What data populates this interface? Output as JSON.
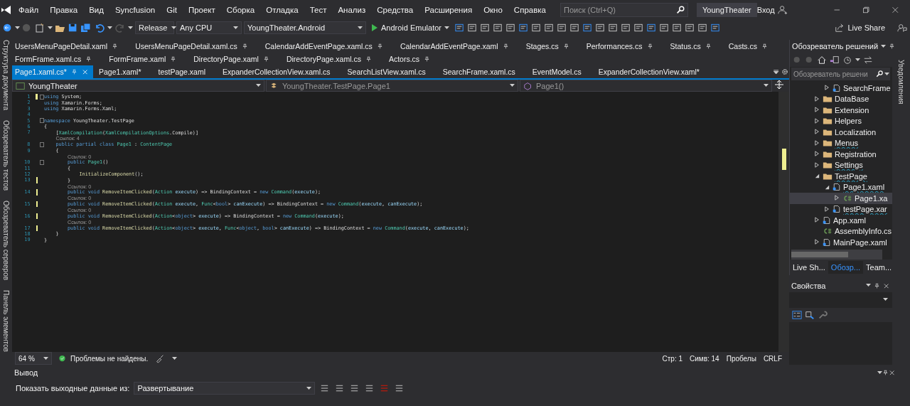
{
  "menu": [
    "Файл",
    "Правка",
    "Вид",
    "Syncfusion",
    "Git",
    "Проект",
    "Сборка",
    "Отладка",
    "Тест",
    "Анализ",
    "Средства",
    "Расширения",
    "Окно",
    "Справка"
  ],
  "search": {
    "placeholder": "Поиск (Ctrl+Q)"
  },
  "window": {
    "title": "YoungTheater",
    "sign_in": "Вход"
  },
  "toolbar": {
    "configuration": "Release",
    "platform": "Any CPU",
    "project": "YoungTheater.Android",
    "run_target": "Android Emulator",
    "live_share": "Live Share"
  },
  "left_strip": [
    "Структура документа",
    "Обозреватель тестов",
    "Обозреватель серверов",
    "Панель элементов"
  ],
  "tab_rows": [
    [
      {
        "label": "UsersMenuPageDetail.xaml",
        "pinned": true,
        "selected": false
      },
      {
        "label": "UsersMenuPageDetail.xaml.cs",
        "pinned": true,
        "selected": false
      },
      {
        "label": "CalendarAddEventPage.xaml.cs",
        "pinned": true,
        "selected": false
      },
      {
        "label": "CalendarAddEventPage.xaml",
        "pinned": true,
        "selected": false
      },
      {
        "label": "Stages.cs",
        "pinned": true,
        "selected": false
      },
      {
        "label": "Performances.cs",
        "pinned": true,
        "selected": false
      },
      {
        "label": "Status.cs",
        "pinned": true,
        "selected": false
      },
      {
        "label": "Casts.cs",
        "pinned": true,
        "selected": false
      }
    ],
    [
      {
        "label": "FormFrame.xaml.cs",
        "pinned": true,
        "selected": false
      },
      {
        "label": "FormFrame.xaml",
        "pinned": true,
        "selected": false
      },
      {
        "label": "DirectoryPage.xaml",
        "pinned": true,
        "selected": false
      },
      {
        "label": "DirectoryPage.xaml.cs",
        "pinned": true,
        "selected": false
      },
      {
        "label": "Actors.cs",
        "pinned": true,
        "selected": false
      }
    ],
    [
      {
        "label": "Page1.xaml.cs*",
        "pinned": true,
        "selected": true
      },
      {
        "label": "Page1.xaml*",
        "pinned": false,
        "selected": false
      },
      {
        "label": "testPage.xaml",
        "pinned": false,
        "selected": false
      },
      {
        "label": "ExpanderCollectionView.xaml.cs",
        "pinned": false,
        "selected": false
      },
      {
        "label": "SearchListView.xaml.cs",
        "pinned": false,
        "selected": false
      },
      {
        "label": "SearchFrame.xaml.cs",
        "pinned": false,
        "selected": false
      },
      {
        "label": "EventModel.cs",
        "pinned": false,
        "selected": false
      },
      {
        "label": "ExpanderCollectionView.xaml*",
        "pinned": false,
        "selected": false
      }
    ]
  ],
  "navbar": {
    "project": "YoungTheater",
    "type": "YoungTheater.TestPage.Page1",
    "member": "Page1()"
  },
  "code": [
    {
      "kind": "line",
      "number": "1",
      "changed": true,
      "fold": true,
      "tokens": [
        {
          "text": "using",
          "kind": "keyword"
        },
        {
          "text": " System;",
          "kind": "plain"
        }
      ]
    },
    {
      "kind": "line",
      "number": "2",
      "changed": false,
      "fold": false,
      "tokens": [
        {
          "text": "using",
          "kind": "keyword"
        },
        {
          "text": " Xamarin.Forms;",
          "kind": "plain"
        }
      ]
    },
    {
      "kind": "line",
      "number": "3",
      "changed": false,
      "fold": false,
      "tokens": [
        {
          "text": "using",
          "kind": "keyword"
        },
        {
          "text": " Xamarin.Forms.Xaml;",
          "kind": "plain"
        }
      ]
    },
    {
      "kind": "line",
      "number": "4",
      "changed": false,
      "fold": false
    },
    {
      "kind": "line",
      "number": "5",
      "changed": false,
      "fold": true,
      "tokens": [
        {
          "text": "namespace",
          "kind": "keyword"
        },
        {
          "text": " YoungTheater.TestPage",
          "kind": "plain"
        }
      ]
    },
    {
      "kind": "line",
      "number": "6",
      "changed": false,
      "fold": false,
      "tokens": [
        {
          "text": "{",
          "kind": "plain"
        }
      ],
      "children": [
        {
          "kind": "line",
          "number": "7",
          "changed": false,
          "fold": false,
          "tokens": [
            {
              "text": "[",
              "kind": "plain"
            },
            {
              "text": "XamlCompilation",
              "kind": "type"
            },
            {
              "text": "(",
              "kind": "plain"
            },
            {
              "text": "XamlCompilationOptions",
              "kind": "type"
            },
            {
              "text": ".Compile)]",
              "kind": "plain"
            }
          ]
        },
        {
          "kind": "lens",
          "text": "Ссылок: 4"
        },
        {
          "kind": "line",
          "number": "8",
          "changed": false,
          "fold": true,
          "tokens": [
            {
              "text": "public partial class",
              "kind": "keyword"
            },
            {
              "text": " Page1",
              "kind": "type"
            },
            {
              "text": " : ",
              "kind": "plain"
            },
            {
              "text": "ContentPage",
              "kind": "type"
            }
          ]
        },
        {
          "kind": "line",
          "number": "9",
          "changed": false,
          "fold": false,
          "tokens": [
            {
              "text": "{",
              "kind": "plain"
            }
          ],
          "children": [
            {
              "kind": "lens",
              "text": "Ссылок: 0"
            },
            {
              "kind": "line",
              "number": "10",
              "changed": false,
              "fold": true,
              "tokens": [
                {
                  "text": "public",
                  "kind": "keyword"
                },
                {
                  "text": " Page1",
                  "kind": "type"
                },
                {
                  "text": "()",
                  "kind": "plain"
                }
              ]
            },
            {
              "kind": "line",
              "number": "11",
              "changed": false,
              "fold": false,
              "tokens": [
                {
                  "text": "{",
                  "kind": "plain"
                }
              ],
              "children": [
                {
                  "kind": "line",
                  "number": "12",
                  "changed": false,
                  "fold": false,
                  "tokens": [
                    {
                      "text": "InitializeComponent",
                      "kind": "method"
                    },
                    {
                      "text": "();",
                      "kind": "plain"
                    }
                  ]
                }
              ]
            },
            {
              "kind": "line",
              "number": "13",
              "changed": true,
              "fold": false,
              "tokens": [
                {
                  "text": "}",
                  "kind": "plain"
                }
              ]
            },
            {
              "kind": "lens",
              "text": "Ссылок: 0"
            },
            {
              "kind": "line",
              "number": "14",
              "changed": true,
              "fold": false,
              "tokens": [
                {
                  "text": "public void",
                  "kind": "keyword"
                },
                {
                  "text": " RemoveItemClicked",
                  "kind": "method"
                },
                {
                  "text": "(",
                  "kind": "plain"
                },
                {
                  "text": "Action",
                  "kind": "type"
                },
                {
                  "text": " execute",
                  "kind": "parameter"
                },
                {
                  "text": ") => BindingContext = ",
                  "kind": "plain"
                },
                {
                  "text": "new",
                  "kind": "keyword"
                },
                {
                  "text": " Command",
                  "kind": "type"
                },
                {
                  "text": "(",
                  "kind": "plain"
                },
                {
                  "text": "execute",
                  "kind": "parameter"
                },
                {
                  "text": ");",
                  "kind": "plain"
                }
              ]
            },
            {
              "kind": "lens",
              "text": "Ссылок: 0"
            },
            {
              "kind": "line",
              "number": "15",
              "changed": true,
              "fold": false,
              "tokens": [
                {
                  "text": "public void",
                  "kind": "keyword"
                },
                {
                  "text": " RemoveItemClicked",
                  "kind": "method"
                },
                {
                  "text": "(",
                  "kind": "plain"
                },
                {
                  "text": "Action",
                  "kind": "type"
                },
                {
                  "text": " execute",
                  "kind": "parameter"
                },
                {
                  "text": ", ",
                  "kind": "plain"
                },
                {
                  "text": "Func",
                  "kind": "type"
                },
                {
                  "text": "<",
                  "kind": "plain"
                },
                {
                  "text": "bool",
                  "kind": "keyword"
                },
                {
                  "text": ">",
                  "kind": "plain"
                },
                {
                  "text": " canExecute",
                  "kind": "parameter"
                },
                {
                  "text": ") => BindingContext = ",
                  "kind": "plain"
                },
                {
                  "text": "new",
                  "kind": "keyword"
                },
                {
                  "text": " Command",
                  "kind": "type"
                },
                {
                  "text": "(",
                  "kind": "plain"
                },
                {
                  "text": "execute",
                  "kind": "parameter"
                },
                {
                  "text": ", ",
                  "kind": "plain"
                },
                {
                  "text": "canExecute",
                  "kind": "parameter"
                },
                {
                  "text": ");",
                  "kind": "plain"
                }
              ]
            },
            {
              "kind": "lens",
              "text": "Ссылок: 0"
            },
            {
              "kind": "line",
              "number": "16",
              "changed": true,
              "fold": false,
              "tokens": [
                {
                  "text": "public void",
                  "kind": "keyword"
                },
                {
                  "text": " RemoveItemClicked",
                  "kind": "method"
                },
                {
                  "text": "(",
                  "kind": "plain"
                },
                {
                  "text": "Action",
                  "kind": "type"
                },
                {
                  "text": "<",
                  "kind": "plain"
                },
                {
                  "text": "object",
                  "kind": "keyword"
                },
                {
                  "text": ">",
                  "kind": "plain"
                },
                {
                  "text": " execute",
                  "kind": "parameter"
                },
                {
                  "text": ") => BindingContext = ",
                  "kind": "plain"
                },
                {
                  "text": "new",
                  "kind": "keyword"
                },
                {
                  "text": " Command",
                  "kind": "type"
                },
                {
                  "text": "(",
                  "kind": "plain"
                },
                {
                  "text": "execute",
                  "kind": "parameter"
                },
                {
                  "text": ");",
                  "kind": "plain"
                }
              ]
            },
            {
              "kind": "lens",
              "text": "Ссылок: 0"
            },
            {
              "kind": "line",
              "number": "17",
              "changed": true,
              "fold": false,
              "tokens": [
                {
                  "text": "public void",
                  "kind": "keyword"
                },
                {
                  "text": " RemoveItemClicked",
                  "kind": "method"
                },
                {
                  "text": "(",
                  "kind": "plain"
                },
                {
                  "text": "Action",
                  "kind": "type"
                },
                {
                  "text": "<",
                  "kind": "plain"
                },
                {
                  "text": "object",
                  "kind": "keyword"
                },
                {
                  "text": ">",
                  "kind": "plain"
                },
                {
                  "text": " execute",
                  "kind": "parameter"
                },
                {
                  "text": ", ",
                  "kind": "plain"
                },
                {
                  "text": "Func",
                  "kind": "type"
                },
                {
                  "text": "<",
                  "kind": "plain"
                },
                {
                  "text": "object",
                  "kind": "keyword"
                },
                {
                  "text": ", ",
                  "kind": "plain"
                },
                {
                  "text": "bool",
                  "kind": "keyword"
                },
                {
                  "text": ">",
                  "kind": "plain"
                },
                {
                  "text": " canExecute",
                  "kind": "parameter"
                },
                {
                  "text": ") => BindingContext = ",
                  "kind": "plain"
                },
                {
                  "text": "new",
                  "kind": "keyword"
                },
                {
                  "text": " Command",
                  "kind": "type"
                },
                {
                  "text": "(",
                  "kind": "plain"
                },
                {
                  "text": "execute",
                  "kind": "parameter"
                },
                {
                  "text": ", ",
                  "kind": "plain"
                },
                {
                  "text": "canExecute",
                  "kind": "parameter"
                },
                {
                  "text": ");",
                  "kind": "plain"
                }
              ]
            }
          ]
        },
        {
          "kind": "line",
          "number": "18",
          "changed": false,
          "fold": false,
          "tokens": [
            {
              "text": "}",
              "kind": "plain"
            }
          ]
        }
      ]
    },
    {
      "kind": "line",
      "number": "19",
      "changed": false,
      "fold": false,
      "tokens": [
        {
          "text": "}",
          "kind": "plain"
        }
      ]
    }
  ],
  "status": {
    "zoom": "64 %",
    "issues": "Проблемы не найдены.",
    "line": "Стр: 1",
    "column": "Симв: 14",
    "whitespace": "Пробелы",
    "line_endings": "CRLF"
  },
  "solution_explorer": {
    "title": "Обозреватель решений",
    "search_placeholder": "Обозреватель решени",
    "orphans": [
      {
        "label": "SearchFrame",
        "kind": "file",
        "expanded": false,
        "squiggle": false,
        "selected": false
      }
    ],
    "tree": [
      {
        "label": "DataBase",
        "kind": "folder",
        "expanded": false,
        "squiggle": false,
        "selected": false
      },
      {
        "label": "Extension",
        "kind": "folder",
        "expanded": false,
        "squiggle": false,
        "selected": false
      },
      {
        "label": "Helpers",
        "kind": "folder",
        "expanded": false,
        "squiggle": false,
        "selected": false
      },
      {
        "label": "Localization",
        "kind": "folder",
        "expanded": false,
        "squiggle": false,
        "selected": false
      },
      {
        "label": "Menus",
        "kind": "folder",
        "expanded": false,
        "squiggle": true,
        "selected": false
      },
      {
        "label": "Registration",
        "kind": "folder",
        "expanded": false,
        "squiggle": false,
        "selected": false
      },
      {
        "label": "Settings",
        "kind": "folder",
        "expanded": false,
        "squiggle": true,
        "selected": false
      },
      {
        "label": "TestPage",
        "kind": "folder",
        "expanded": true,
        "squiggle": true,
        "selected": false,
        "children": [
          {
            "label": "Page1.xaml",
            "kind": "file",
            "expanded": true,
            "squiggle": true,
            "selected": false,
            "children": [
              {
                "label": "Page1.xa",
                "kind": "csharp",
                "expanded": false,
                "squiggle": false,
                "selected": true
              }
            ]
          },
          {
            "label": "testPage.xar",
            "kind": "file",
            "expanded": false,
            "squiggle": true,
            "selected": false
          }
        ]
      },
      {
        "label": "App.xaml",
        "kind": "file",
        "expanded": false,
        "squiggle": false,
        "selected": false
      },
      {
        "label": "AssemblyInfo.cs",
        "kind": "csharp",
        "squiggle": false,
        "selected": false
      },
      {
        "label": "MainPage.xaml",
        "kind": "file",
        "expanded": false,
        "squiggle": false,
        "selected": false
      }
    ],
    "bottom_tabs": [
      {
        "label": "Live Sh...",
        "selected": false
      },
      {
        "label": "Обозр...",
        "selected": true
      },
      {
        "label": "Team...",
        "selected": false
      }
    ]
  },
  "properties": {
    "title": "Свойства"
  },
  "notifications": "Уведомления",
  "output": {
    "title": "Вывод",
    "source_label": "Показать выходные данные из:",
    "source": "Развертывание"
  }
}
